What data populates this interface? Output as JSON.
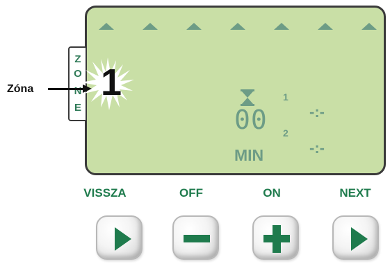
{
  "zone_tab": {
    "letters": [
      "Z",
      "O",
      "N",
      "E"
    ]
  },
  "callout": {
    "label": "Zóna"
  },
  "display": {
    "zone_number": "1",
    "program_1_label": "1",
    "program_2_label": "2",
    "program_1_time": "-:-",
    "program_2_time": "-:-",
    "minutes_value": "00",
    "unit": "MIN"
  },
  "buttons": [
    {
      "label": "VISSZA",
      "icon": "play-right-icon"
    },
    {
      "label": "OFF",
      "icon": "minus-icon"
    },
    {
      "label": "ON",
      "icon": "plus-icon"
    },
    {
      "label": "NEXT",
      "icon": "play-right-icon"
    }
  ],
  "colors": {
    "lcd_background": "#c9dfa6",
    "lcd_segment": "#6d9c86",
    "button_green": "#1f7b4d"
  }
}
